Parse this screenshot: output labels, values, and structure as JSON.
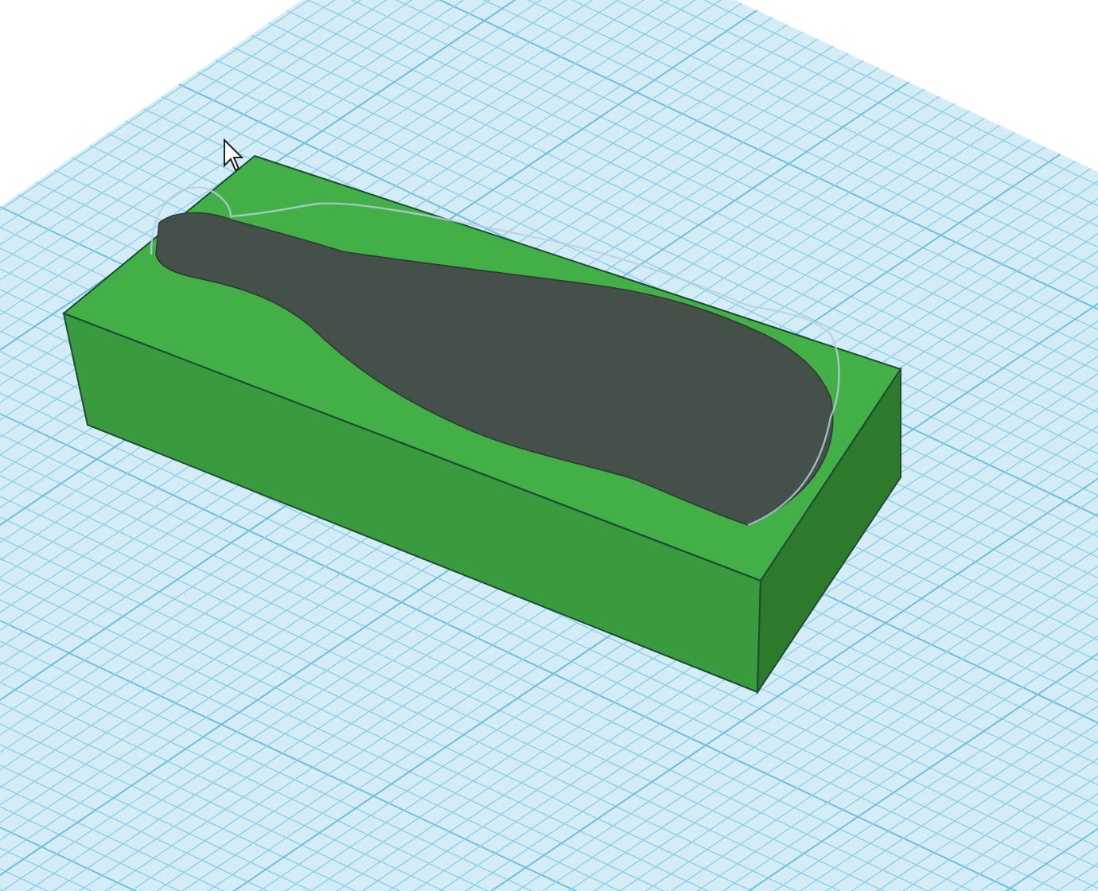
{
  "viewport": {
    "kind": "workplane"
  },
  "objects": [
    {
      "kind": "box"
    },
    {
      "kind": "hole"
    }
  ],
  "cursor": {
    "kind": "arrow"
  }
}
